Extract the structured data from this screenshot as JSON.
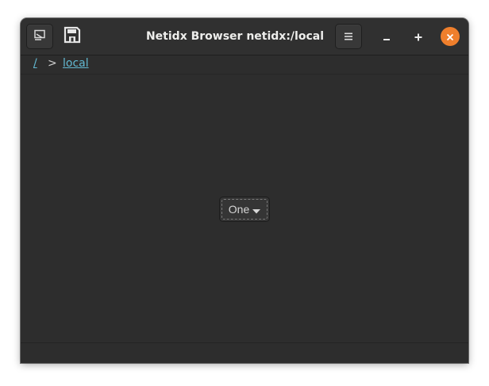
{
  "window": {
    "title": "Netidx Browser netidx:/local"
  },
  "headerbar": {
    "left_buttons": [
      {
        "icon": "design-mode-icon"
      },
      {
        "icon": "save-icon"
      }
    ],
    "menu_icon": "hamburger-menu-icon",
    "controls": {
      "minimize_icon": "minimize-icon",
      "maximize_icon": "maximize-icon",
      "close_icon": "close-icon",
      "close_color": "#ef7f2c"
    }
  },
  "breadcrumb": {
    "root": "/",
    "separator": ">",
    "current": "local",
    "link_color": "#62b8d1"
  },
  "combo": {
    "selected": "One",
    "icon": "dropdown-arrow-icon"
  }
}
